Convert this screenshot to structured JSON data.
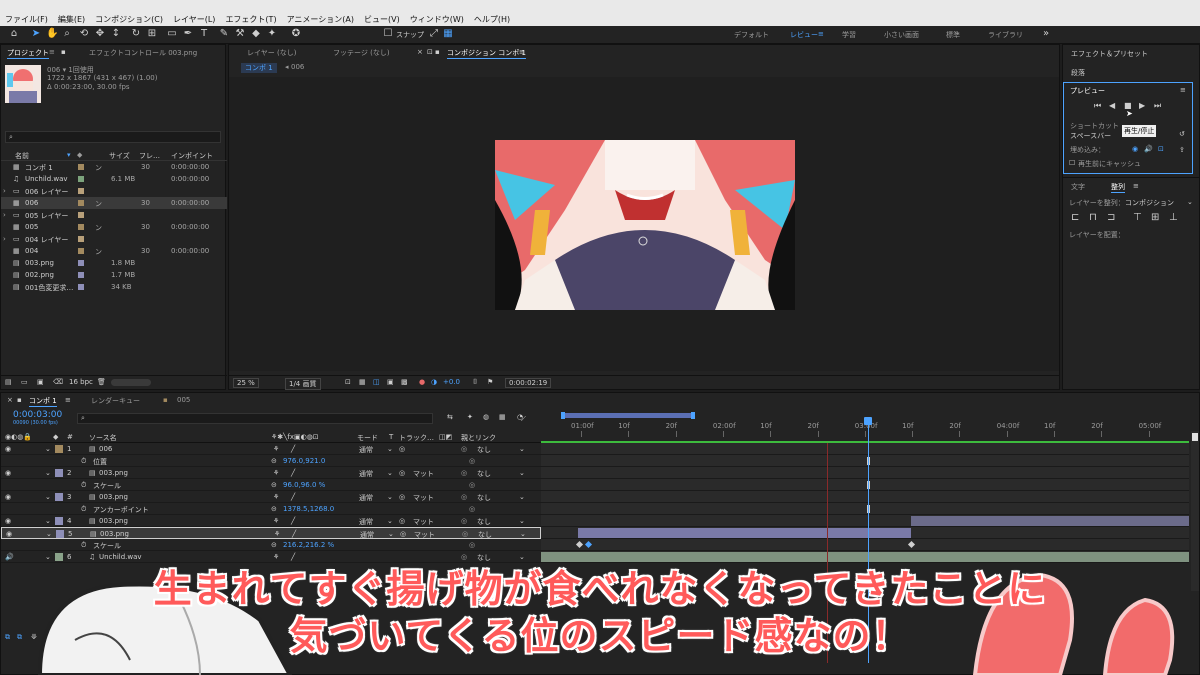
{
  "menu": [
    "ファイル(F)",
    "編集(E)",
    "コンポジション(C)",
    "レイヤー(L)",
    "エフェクト(T)",
    "アニメーション(A)",
    "ビュー(V)",
    "ウィンドウ(W)",
    "ヘルプ(H)"
  ],
  "toolbar": {
    "snap_label": "スナップ",
    "workspaces": [
      "デフォルト",
      "レビュー",
      "学習",
      "小さい画面",
      "標準",
      "ライブラリ"
    ],
    "active_workspace": "レビュー"
  },
  "project": {
    "tab_project": "プロジェクト",
    "tab_effect": "エフェクトコントロール 003.png",
    "asset_name": "006 ▾ 1回使用",
    "asset_size": "1722 x 1867 (431 x 467) (1.00)",
    "asset_duration": "Δ 0:00:23:00, 30.00 fps",
    "search_placeholder": "",
    "columns": [
      "名前",
      "サイズ",
      "フレ…",
      "インポイント"
    ],
    "items": [
      {
        "name": "コンポ 1",
        "size": "",
        "fps": "30",
        "in": "0:00:00:00",
        "type": "comp"
      },
      {
        "name": "Unchild.wav",
        "size": "6.1 MB",
        "fps": "",
        "in": "0:00:00:00",
        "type": "audio"
      },
      {
        "name": "006 レイヤー",
        "size": "",
        "fps": "",
        "in": "",
        "type": "folder"
      },
      {
        "name": "006",
        "size": "",
        "fps": "30",
        "in": "0:00:00:00",
        "type": "comp",
        "selected": true
      },
      {
        "name": "005 レイヤー",
        "size": "",
        "fps": "",
        "in": "",
        "type": "folder"
      },
      {
        "name": "005",
        "size": "",
        "fps": "30",
        "in": "0:00:00:00",
        "type": "comp"
      },
      {
        "name": "004 レイヤー",
        "size": "",
        "fps": "",
        "in": "",
        "type": "folder"
      },
      {
        "name": "004",
        "size": "",
        "fps": "30",
        "in": "0:00:00:00",
        "type": "comp"
      },
      {
        "name": "003.png",
        "size": "1.8 MB",
        "fps": "",
        "in": "",
        "type": "image"
      },
      {
        "name": "002.png",
        "size": "1.7 MB",
        "fps": "",
        "in": "",
        "type": "image"
      },
      {
        "name": "001色変更求…",
        "size": "34 KB",
        "fps": "",
        "in": "",
        "type": "image"
      }
    ],
    "bpc": "16 bpc"
  },
  "viewer": {
    "tabs": [
      "レイヤー (なし)",
      "フッテージ (なし)",
      "コンポジション コンポ 1"
    ],
    "breadcrumb_comp": "コンポ 1",
    "breadcrumb_child": "006",
    "zoom": "25 %",
    "resolution": "1/4 画質",
    "exposure": "+0.0",
    "timecode": "0:00:02:19"
  },
  "right": {
    "effects_presets": "エフェクト＆プリセット",
    "paragraph": "段落",
    "preview_title": "プレビュー",
    "tooltip": "再生/停止",
    "shortcut_label": "ショートカット",
    "shortcut_value": "スペースバー",
    "include_label": "埋め込み：",
    "cache_label": "再生前にキャッシュ",
    "tab_text": "文字",
    "tab_align": "整列",
    "align_to_label": "レイヤーを整列：",
    "align_to_value": "コンポジション",
    "distribute_label": "レイヤーを配置："
  },
  "timeline": {
    "tab_comp": "コンポ 1",
    "tab_render": "レンダーキュー",
    "tab_006": "005",
    "current_time": "0:00:03:00",
    "current_frames": "00090 (30.00 fps)",
    "headers": {
      "source": "ソース名",
      "mode": "モード",
      "t": "T",
      "track": "トラック…",
      "parent": "親とリンク"
    },
    "ruler": [
      "01:00f",
      "10f",
      "20f",
      "02:00f",
      "10f",
      "20f",
      "03:00f",
      "10f",
      "20f",
      "04:00f",
      "10f",
      "20f",
      "05:00f"
    ],
    "layers": [
      {
        "num": "1",
        "name": "006",
        "mode": "通常",
        "track": "",
        "parent": "なし",
        "color": "#a38a5f",
        "type": "comp"
      },
      {
        "prop": "位置",
        "value": "976.0,921.0"
      },
      {
        "num": "2",
        "name": "003.png",
        "mode": "通常",
        "track": "マット",
        "parent": "なし",
        "color": "#8e8fb8",
        "type": "image"
      },
      {
        "prop": "スケール",
        "value": "96.0,96.0 %"
      },
      {
        "num": "3",
        "name": "003.png",
        "mode": "通常",
        "track": "マット",
        "parent": "なし",
        "color": "#8e8fb8",
        "type": "image"
      },
      {
        "prop": "アンカーポイント",
        "value": "1378.5,1268.0"
      },
      {
        "num": "4",
        "name": "003.png",
        "mode": "通常",
        "track": "マット",
        "parent": "なし",
        "color": "#8e8fb8",
        "type": "image"
      },
      {
        "num": "5",
        "name": "003.png",
        "mode": "通常",
        "track": "マット",
        "parent": "なし",
        "color": "#8e8fb8",
        "type": "image",
        "selected": true
      },
      {
        "prop": "スケール",
        "value": "216.2,216.2 %"
      },
      {
        "num": "6",
        "name": "Unchild.wav",
        "mode": "",
        "track": "",
        "parent": "なし",
        "color": "#8aa38a",
        "type": "audio"
      }
    ]
  },
  "caption": {
    "line1": "生まれてすぐ揚げ物が食べれなくなってきたことに",
    "line2": "気づいてくる位のスピード感なの！"
  },
  "colors": {
    "accent": "#4da3ff",
    "caption": "#ff5a5a",
    "work_area": "#5b6fb3"
  }
}
